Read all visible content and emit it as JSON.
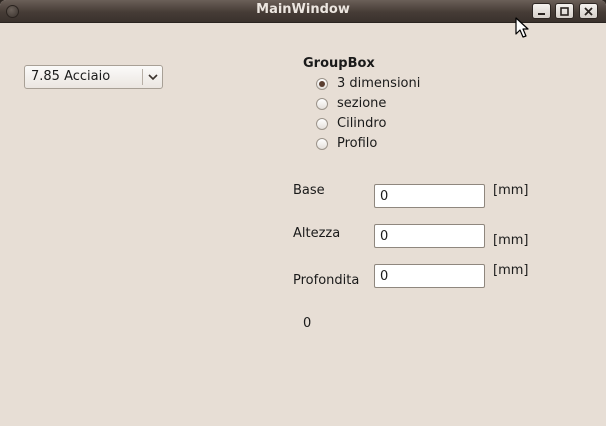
{
  "window": {
    "title": "MainWindow"
  },
  "material_combo": {
    "selected": "7.85 Acciaio"
  },
  "groupbox": {
    "title": "GroupBox",
    "options": [
      {
        "label": "3 dimensioni",
        "checked": true
      },
      {
        "label": "sezione",
        "checked": false
      },
      {
        "label": "Cilindro",
        "checked": false
      },
      {
        "label": "Profilo",
        "checked": false
      }
    ]
  },
  "fields": {
    "base": {
      "label": "Base",
      "value": "0",
      "unit": "[mm]"
    },
    "altezza": {
      "label": "Altezza",
      "value": "0",
      "unit": "[mm]"
    },
    "profondita": {
      "label": "Profondita",
      "value": "0",
      "unit": "[mm]"
    }
  },
  "result": {
    "value": "0"
  },
  "colors": {
    "titlebar": "#463c36",
    "window_bg": "#e7ded5",
    "radio_checked": "#5a3e30"
  },
  "icons": [
    "window-menu-icon",
    "minimize-icon",
    "maximize-icon",
    "close-icon",
    "chevron-down-icon",
    "mouse-cursor-icon"
  ]
}
